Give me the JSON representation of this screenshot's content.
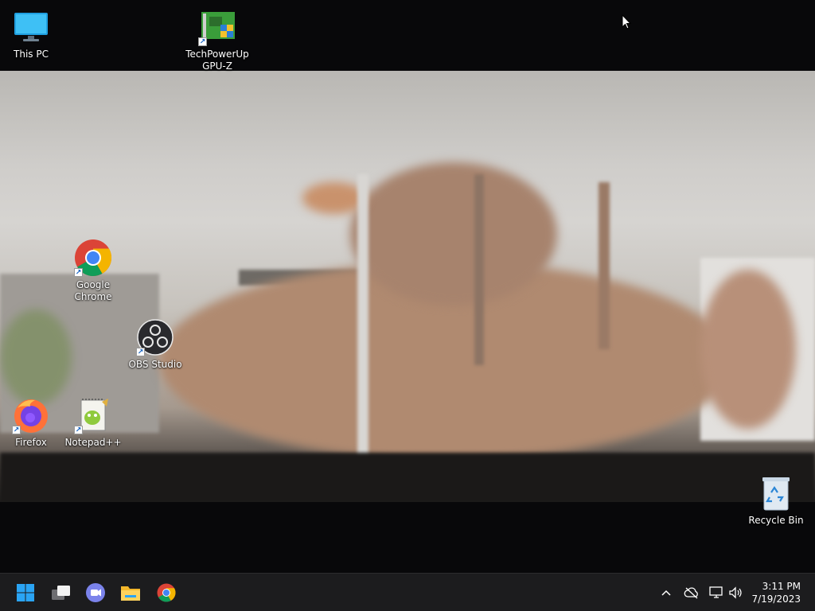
{
  "desktop": {
    "icons": {
      "this_pc": {
        "label": "This PC",
        "icon": "monitor-icon"
      },
      "gpuz": {
        "label": "TechPowerUp\nGPU-Z",
        "line1": "TechPowerUp",
        "line2": "GPU-Z",
        "icon": "gpuz-icon"
      },
      "chrome": {
        "line1": "Google",
        "line2": "Chrome",
        "icon": "chrome-icon"
      },
      "obs": {
        "label": "OBS Studio",
        "icon": "obs-icon"
      },
      "firefox": {
        "label": "Firefox",
        "icon": "firefox-icon"
      },
      "notepadpp": {
        "label": "Notepad++",
        "icon": "notepadpp-icon"
      },
      "recycle_bin": {
        "label": "Recycle Bin",
        "icon": "recycle-bin-icon"
      }
    }
  },
  "taskbar": {
    "pinned": [
      {
        "name": "start-button",
        "icon": "windows-logo-icon"
      },
      {
        "name": "task-view-button",
        "icon": "task-view-icon"
      },
      {
        "name": "teams-chat-button",
        "icon": "chat-icon"
      },
      {
        "name": "file-explorer-button",
        "icon": "folder-icon"
      },
      {
        "name": "chrome-taskbar-button",
        "icon": "chrome-icon"
      }
    ],
    "tray": {
      "overflow_icon": "chevron-up-icon",
      "onedrive_icon": "cloud-offline-icon",
      "network_icon": "network-icon",
      "volume_icon": "speaker-icon"
    },
    "clock": {
      "time": "3:11 PM",
      "date": "7/19/2023"
    }
  },
  "colors": {
    "taskbar_bg": "#1c1c1e",
    "desktop_bg": "#08080a",
    "accent_blue": "#0078d4"
  }
}
